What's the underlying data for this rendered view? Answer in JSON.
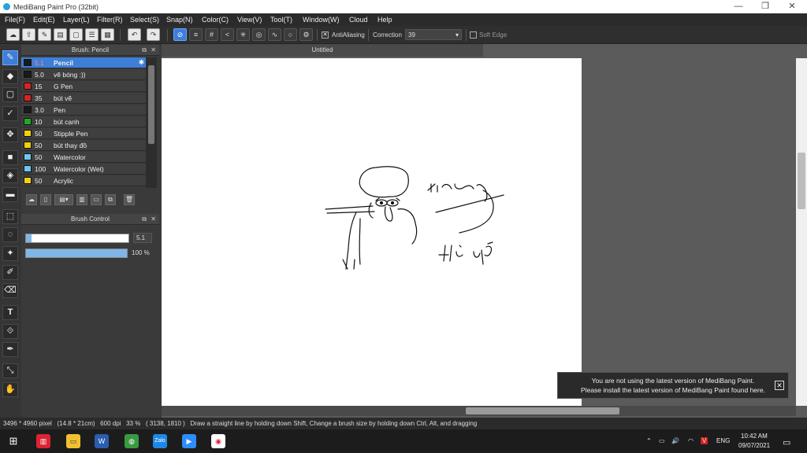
{
  "app": {
    "title": "MediBang Paint Pro (32bit)"
  },
  "window_controls": {
    "minimize": "—",
    "maximize": "❐",
    "close": "✕"
  },
  "menu": [
    "File(F)",
    "Edit(E)",
    "Layer(L)",
    "Filter(R)",
    "Select(S)",
    "Snap(N)",
    "Color(C)",
    "View(V)",
    "Tool(T)",
    "Window(W)",
    "Cloud",
    "Help"
  ],
  "toolbar": {
    "antialiasing_label": "AntiAliasing",
    "antialiasing_checked": true,
    "correction_label": "Correction",
    "correction_value": "39",
    "soft_edge_label": "Soft Edge"
  },
  "brush_panel": {
    "title": "Brush: Pencil",
    "items": [
      {
        "size": "5.1",
        "name": "Pencil",
        "color": "#1a1a1a",
        "selected": true
      },
      {
        "size": "5.0",
        "name": "vẽ bóng :))",
        "color": "#1a1a1a"
      },
      {
        "size": "15",
        "name": "G Pen",
        "color": "#e02020"
      },
      {
        "size": "35",
        "name": "bút vẽ",
        "color": "#e02020"
      },
      {
        "size": "3.0",
        "name": "Pen",
        "color": "#1a1a1a"
      },
      {
        "size": "10",
        "name": "bút cạnh",
        "color": "#22aa22"
      },
      {
        "size": "50",
        "name": "Stipple Pen",
        "color": "#f0d010"
      },
      {
        "size": "50",
        "name": "bút thay đồ",
        "color": "#f0d010"
      },
      {
        "size": "50",
        "name": "Watercolor",
        "color": "#6ec6f0"
      },
      {
        "size": "100",
        "name": "Watercolor (Wet)",
        "color": "#6ec6f0"
      },
      {
        "size": "50",
        "name": "Acrylic",
        "color": "#f0d010"
      }
    ]
  },
  "brush_control": {
    "title": "Brush Control",
    "size_value": "5.1",
    "size_fraction": 0.05,
    "opacity_value": "100 %",
    "opacity_fraction": 1.0
  },
  "document": {
    "tab": "Untitled"
  },
  "toast": {
    "line1": "You are not using the latest version of MediBang Paint.",
    "line2": "Please install the latest version of MediBang Paint found here.",
    "close": "✕"
  },
  "status": {
    "text": "3496 * 4960 pixel   (14.8 * 21cm)   600 dpi   33 %   ( 3138, 1810 )   Draw a straight line by holding down Shift, Change a brush size by holding down Ctrl, Alt, and dragging"
  },
  "taskbar": {
    "time": "10:42 AM",
    "date": "09/07/2021",
    "lang": "ENG",
    "zalo": "Zalo"
  }
}
